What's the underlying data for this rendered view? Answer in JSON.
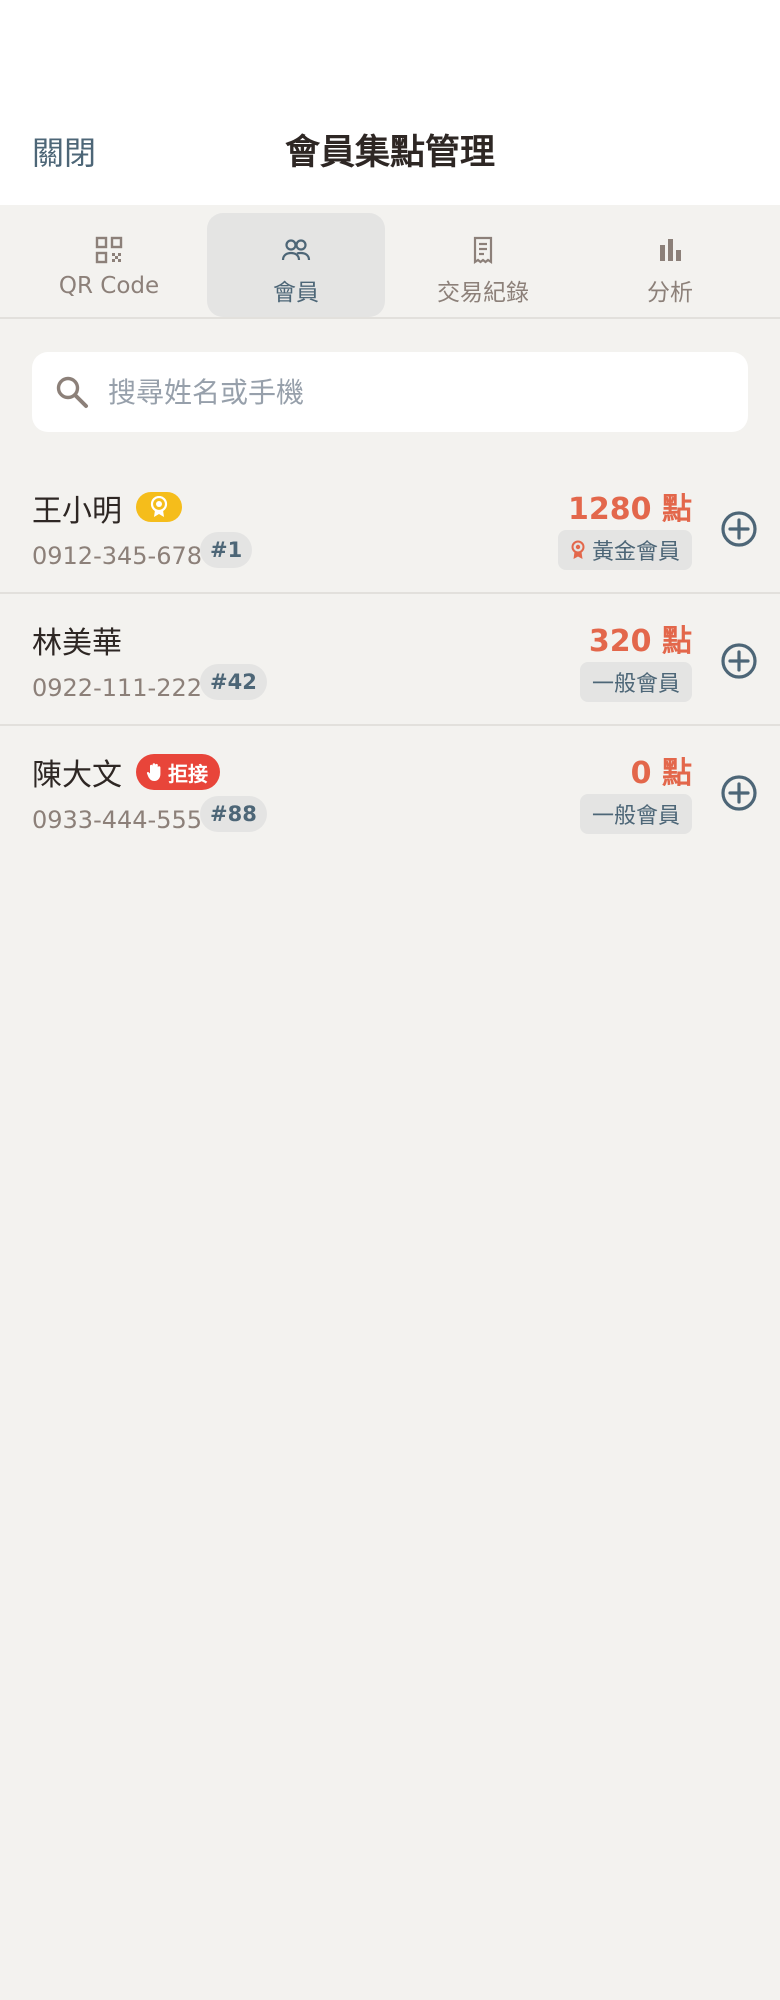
{
  "header": {
    "close_label": "關閉",
    "title": "會員集點管理"
  },
  "tabs": [
    {
      "label": "QR Code",
      "icon": "qr-code-icon",
      "active": false
    },
    {
      "label": "會員",
      "icon": "members-icon",
      "active": true
    },
    {
      "label": "交易紀錄",
      "icon": "receipt-icon",
      "active": false
    },
    {
      "label": "分析",
      "icon": "bar-chart-icon",
      "active": false
    }
  ],
  "search": {
    "placeholder": "搜尋姓名或手機",
    "value": ""
  },
  "members": [
    {
      "name": "王小明",
      "phone": "0912-345-678",
      "number": "#1",
      "points": "1280 點",
      "level": "黃金會員",
      "badge": "gold-medal-icon"
    },
    {
      "name": "林美華",
      "phone": "0922-111-222",
      "number": "#42",
      "points": "320 點",
      "level": "一般會員",
      "badge": ""
    },
    {
      "name": "陳大文",
      "phone": "0933-444-555",
      "number": "#88",
      "points": "0 點",
      "level": "一般會員",
      "badge_label": "拒接"
    }
  ],
  "colors": {
    "accent": "#4d6677",
    "points": "#e3674b",
    "gold": "#f5bd1b",
    "reject": "#e8453a",
    "background": "#f3f2ef"
  }
}
